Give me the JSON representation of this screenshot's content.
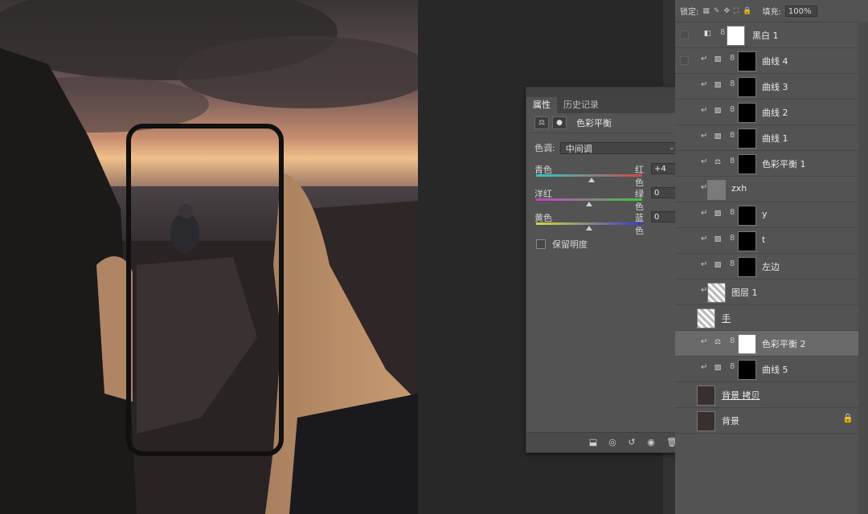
{
  "properties": {
    "tabs": [
      "属性",
      "历史记录"
    ],
    "adjustment_title": "色彩平衡",
    "tone_label": "色调:",
    "tone_value": "中间调",
    "sliders": [
      {
        "left": "青色",
        "right": "红色",
        "value": "+4",
        "level": 0.52
      },
      {
        "left": "洋红",
        "right": "绿色",
        "value": "0",
        "level": 0.5
      },
      {
        "left": "黄色",
        "right": "蓝色",
        "value": "0",
        "level": 0.5
      }
    ],
    "preserve_label": "保留明度"
  },
  "layers": {
    "lock_label": "锁定:",
    "fill_label": "填充:",
    "fill_value": "100%",
    "items": [
      {
        "name": "黑白 1"
      },
      {
        "name": "曲线 4"
      },
      {
        "name": "曲线 3"
      },
      {
        "name": "曲线 2"
      },
      {
        "name": "曲线 1"
      },
      {
        "name": "色彩平衡 1"
      },
      {
        "name": "zxh"
      },
      {
        "name": "y"
      },
      {
        "name": "t"
      },
      {
        "name": "左边"
      },
      {
        "name": "图层 1"
      },
      {
        "name": "手"
      },
      {
        "name": "色彩平衡 2"
      },
      {
        "name": "曲线 5"
      },
      {
        "name": "背景 拷贝"
      },
      {
        "name": "背景"
      }
    ]
  },
  "colors": {
    "panel_bg": "#535353",
    "selected_row": "#6a6a6a",
    "workspace": "#282828"
  }
}
